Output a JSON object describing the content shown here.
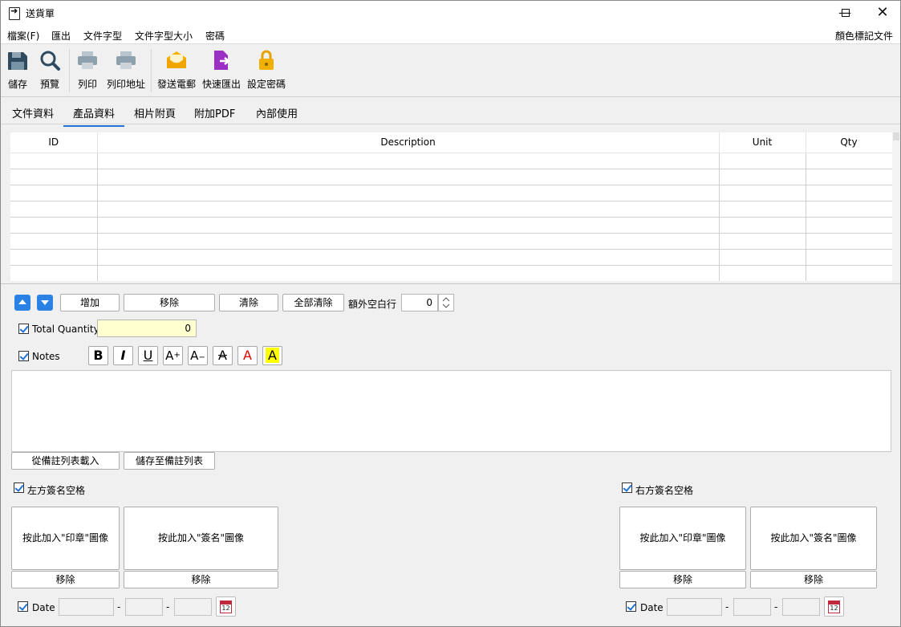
{
  "window": {
    "title": "送貨單",
    "minimize_icon": "minimize-icon",
    "maximize_icon": "maximize-icon",
    "close_icon": "close-icon"
  },
  "menubar": {
    "items": [
      "檔案(F)",
      "匯出",
      "文件字型",
      "文件字型大小",
      "密碼"
    ],
    "right_item": "顏色標記文件"
  },
  "toolbar": {
    "items": [
      {
        "label": "儲存",
        "icon": "save-icon"
      },
      {
        "label": "預覽",
        "icon": "preview-icon"
      },
      {
        "label": "列印",
        "icon": "print-icon"
      },
      {
        "label": "列印地址",
        "icon": "print-address-icon"
      },
      {
        "label": "發送電郵",
        "icon": "email-icon"
      },
      {
        "label": "快速匯出",
        "icon": "quick-export-icon"
      },
      {
        "label": "設定密碼",
        "icon": "lock-icon"
      }
    ],
    "colors": {
      "save": "#2f4a5f",
      "printer": "#8da0ad",
      "email": "#f0a500",
      "export": "#9b2fc4",
      "lock": "#e6a300"
    }
  },
  "tabs": [
    "文件資料",
    "產品資料",
    "相片附頁",
    "附加PDF",
    "內部使用"
  ],
  "active_tab": "產品資料",
  "table": {
    "headers": [
      "ID",
      "Description",
      "Unit",
      "Qty"
    ],
    "row_count": 8
  },
  "row_controls": {
    "up_icon": "arrow-up-icon",
    "down_icon": "arrow-down-icon",
    "add": "增加",
    "remove": "移除",
    "clear": "清除",
    "clear_all": "全部清除",
    "extra_rows_label": "額外空白行",
    "extra_rows_value": "0"
  },
  "total_quantity": {
    "label": "Total Quantity",
    "value": "0",
    "checked": true
  },
  "notes": {
    "label": "Notes",
    "checked": true,
    "format_buttons": [
      {
        "glyph": "B",
        "icon": "bold-icon"
      },
      {
        "glyph": "I",
        "icon": "italic-icon"
      },
      {
        "glyph": "U",
        "icon": "underline-icon"
      },
      {
        "glyph": "A+",
        "icon": "font-larger-icon"
      },
      {
        "glyph": "A−",
        "icon": "font-smaller-icon"
      },
      {
        "glyph": "A",
        "icon": "strikethrough-icon"
      },
      {
        "glyph": "A",
        "icon": "font-color-icon"
      },
      {
        "glyph": "A",
        "icon": "highlight-icon"
      }
    ],
    "load_button": "從備註列表載入",
    "save_button": "儲存至備註列表"
  },
  "signatures": {
    "left": {
      "label": "左方簽名空格",
      "stamp_button": "按此加入\"印章\"圖像",
      "sign_button": "按此加入\"簽名\"圖像",
      "remove": "移除",
      "date_label": "Date"
    },
    "right": {
      "label": "右方簽名空格",
      "stamp_button": "按此加入\"印章\"圖像",
      "sign_button": "按此加入\"簽名\"圖像",
      "remove": "移除",
      "date_label": "Date"
    },
    "date_separator": "-",
    "calendar_icon": "calendar-icon",
    "calendar_day": "12"
  }
}
